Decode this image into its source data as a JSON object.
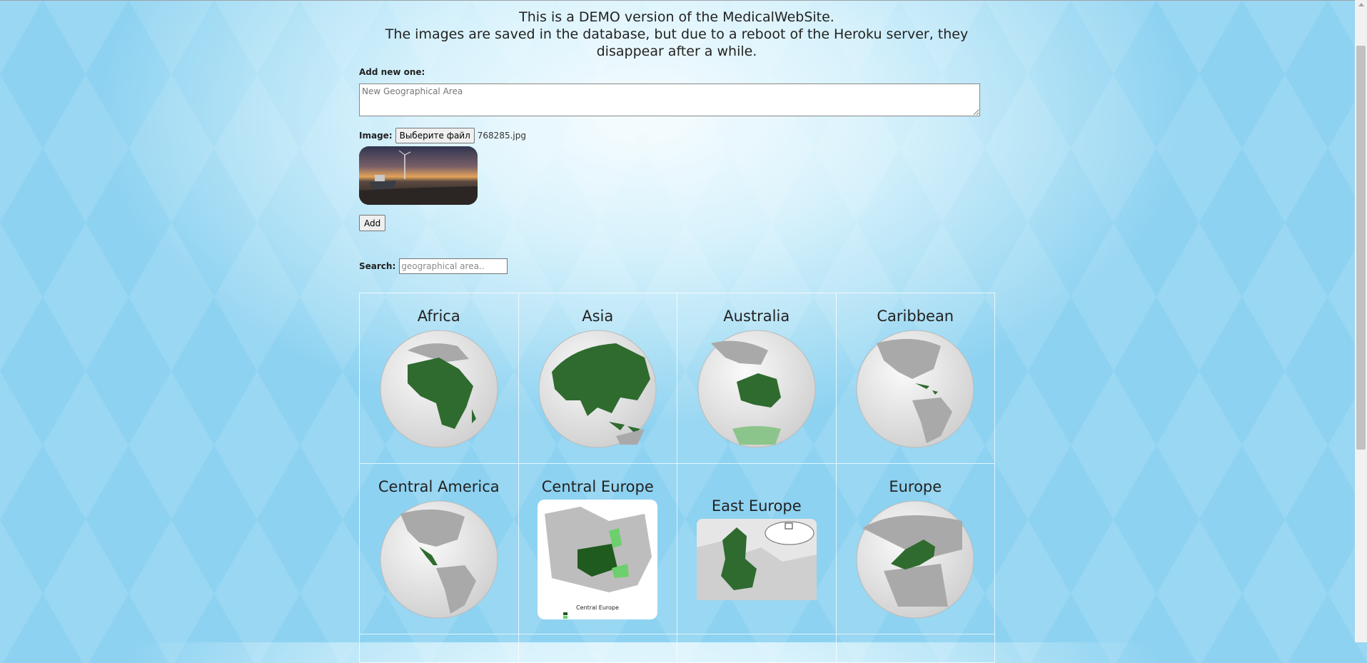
{
  "notice": {
    "line1": "This is a DEMO version of the MedicalWebSite.",
    "line2": "The images are saved in the database, but due to a reboot of the Heroku server, they disappear after a while."
  },
  "form": {
    "add_label": "Add new one:",
    "area_placeholder": "New Geographical Area",
    "image_label": "Image:",
    "file_button": "Выберите файл",
    "file_name": "768285.jpg",
    "add_button": "Add"
  },
  "search": {
    "label": "Search:",
    "placeholder": "geographical area.."
  },
  "areas": [
    {
      "name": "Africa",
      "highlight": "#2f6b2f"
    },
    {
      "name": "Asia",
      "highlight": "#2f6b2f"
    },
    {
      "name": "Australia",
      "highlight": "#2f6b2f"
    },
    {
      "name": "Caribbean",
      "highlight": "#2f6b2f"
    },
    {
      "name": "Central America",
      "highlight": "#2f6b2f"
    },
    {
      "name": "Central Europe",
      "highlight": "#1f5a1f"
    },
    {
      "name": "East Europe",
      "highlight": "#2f6b2f"
    },
    {
      "name": "Europe",
      "highlight": "#2f6b2f"
    }
  ],
  "map_legend": "Central Europe"
}
